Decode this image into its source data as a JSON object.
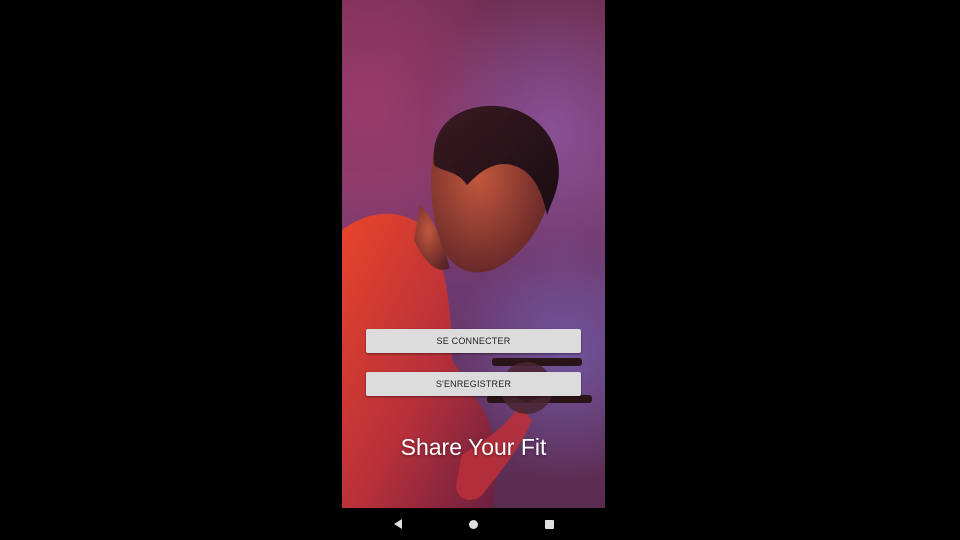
{
  "screen": {
    "login_button": "SE CONNECTER",
    "register_button": "S'ENREGISTRER",
    "tagline": "Share Your Fit"
  },
  "navigation_bar": {
    "back_icon": "back-triangle-icon",
    "home_icon": "home-circle-icon",
    "recents_icon": "recents-square-icon"
  },
  "colors": {
    "page_background": "#000000",
    "button_background": "#dcdcdc",
    "button_text": "#222222",
    "tagline_text": "#ffffff"
  }
}
